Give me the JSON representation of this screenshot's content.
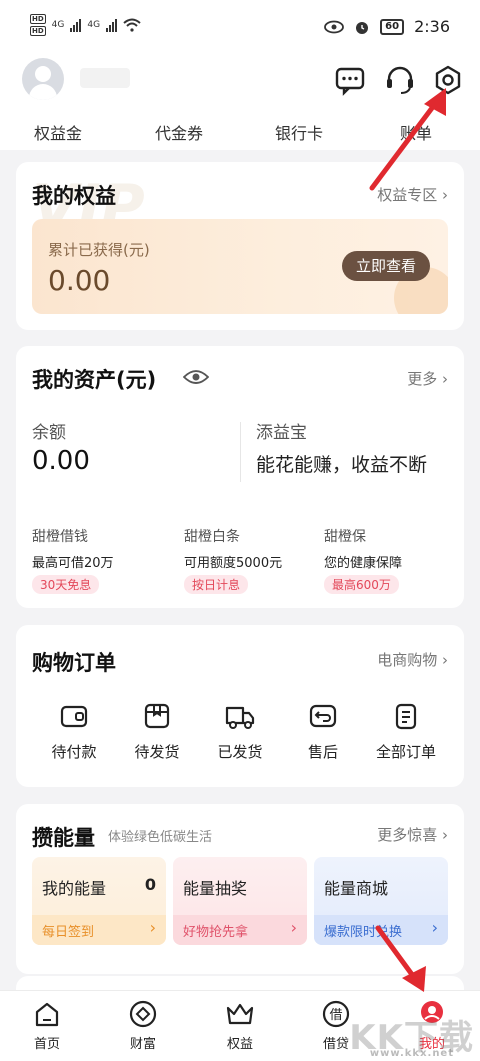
{
  "status_bar": {
    "network_left": "HD",
    "signal_4g_1": "4G",
    "signal_4g_2": "4G",
    "battery": "60",
    "time": "2:36"
  },
  "top_nav": [
    "权益金",
    "代金券",
    "银行卡",
    "账单"
  ],
  "rights": {
    "title": "我的权益",
    "link": "权益专区 ›",
    "earned_label": "累计已获得(元)",
    "earned_value": "0.00",
    "view_button": "立即查看",
    "watermark": "VIP"
  },
  "assets": {
    "title": "我的资产(元)",
    "more": "更多 ›",
    "balance_label": "余额",
    "balance_value": "0.00",
    "fund_label": "添益宝",
    "fund_desc": "能花能赚，收益不断",
    "loans": [
      {
        "name": "甜橙借钱",
        "sub": "最高可借20万",
        "tag": "30天免息"
      },
      {
        "name": "甜橙白条",
        "sub": "可用额度5000元",
        "tag": "按日计息"
      },
      {
        "name": "甜橙保",
        "sub": "您的健康保障",
        "tag": "最高600万"
      }
    ]
  },
  "orders": {
    "title": "购物订单",
    "link": "电商购物 ›",
    "items": [
      {
        "label": "待付款",
        "icon": "wallet-icon"
      },
      {
        "label": "待发货",
        "icon": "package-icon"
      },
      {
        "label": "已发货",
        "icon": "truck-icon"
      },
      {
        "label": "售后",
        "icon": "return-icon"
      },
      {
        "label": "全部订单",
        "icon": "clipboard-icon"
      }
    ]
  },
  "energy": {
    "title": "攒能量",
    "subtitle": "体验绿色低碳生活",
    "link": "更多惊喜 ›",
    "tiles": [
      {
        "title": "我的能量",
        "count": "0",
        "foot": "每日签到",
        "color": "#f0a13a"
      },
      {
        "title": "能量抽奖",
        "count": "",
        "foot": "好物抢先拿",
        "color": "#ea5f72"
      },
      {
        "title": "能量商城",
        "count": "",
        "foot": "爆款限时兑换",
        "color": "#4a7fd8"
      }
    ]
  },
  "tabs": [
    {
      "label": "首页",
      "icon": "home-icon"
    },
    {
      "label": "财富",
      "icon": "wealth-icon"
    },
    {
      "label": "权益",
      "icon": "crown-icon"
    },
    {
      "label": "借贷",
      "icon": "loan-icon",
      "glyph": "借"
    },
    {
      "label": "我的",
      "icon": "profile-icon"
    }
  ],
  "watermark": {
    "text": "KK下载",
    "url": "www.kkx.net"
  },
  "colors": {
    "accent_red": "#e8303f",
    "arrow_red": "#e0292f"
  }
}
